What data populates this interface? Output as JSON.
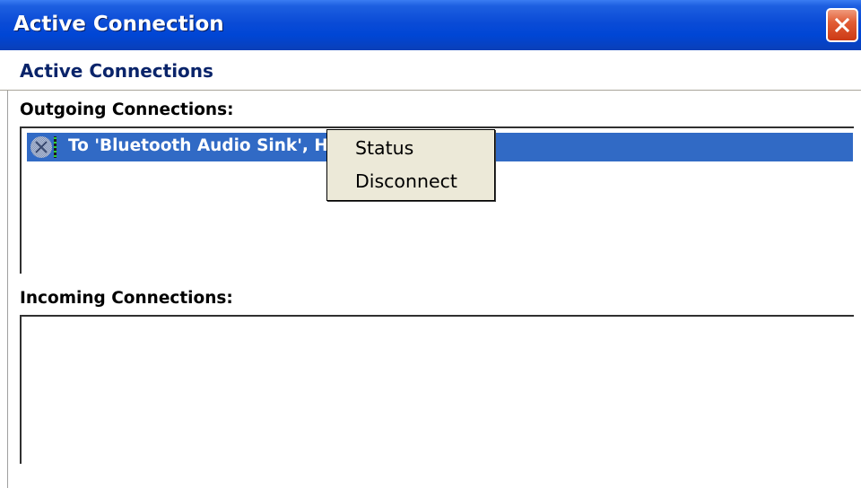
{
  "window": {
    "title": "Active Connection",
    "close_icon": "close-x-icon",
    "title_bar_color": "#0a4bd6",
    "close_button_color": "#e25d35"
  },
  "header": {
    "title": "Active Connections",
    "title_color": "#0a246a"
  },
  "outgoing": {
    "label": "Outgoing Connections:",
    "items": [
      {
        "icon": "bluetooth-connection-icon",
        "text": "To 'Bluetooth Audio Sink', Headset'",
        "selected": true
      }
    ],
    "selection_color": "#316ac5"
  },
  "incoming": {
    "label": "Incoming Connections:",
    "items": []
  },
  "context_menu": {
    "items": [
      {
        "label": "Status"
      },
      {
        "label": "Disconnect"
      }
    ],
    "background": "#ece9d8"
  }
}
